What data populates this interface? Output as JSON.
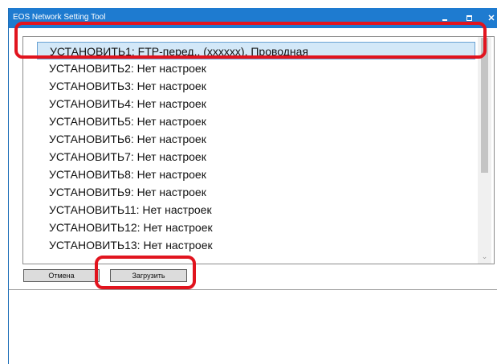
{
  "window": {
    "title": "EOS Network Setting Tool"
  },
  "list": {
    "items": [
      "УСТАНОВИТЬ1: FTP-перед., (xxxxxx), Проводная",
      "УСТАНОВИТЬ2: Нет настроек",
      "УСТАНОВИТЬ3: Нет настроек",
      "УСТАНОВИТЬ4: Нет настроек",
      "УСТАНОВИТЬ5: Нет настроек",
      "УСТАНОВИТЬ6: Нет настроек",
      "УСТАНОВИТЬ7: Нет настроек",
      "УСТАНОВИТЬ8: Нет настроек",
      "УСТАНОВИТЬ9: Нет настроек",
      "УСТАНОВИТЬ11: Нет настроек",
      "УСТАНОВИТЬ12: Нет настроек",
      "УСТАНОВИТЬ13: Нет настроек"
    ],
    "selected_index": 0
  },
  "buttons": {
    "cancel": "Отмена",
    "load": "Загрузить"
  },
  "colors": {
    "titlebar": "#1e7bd0",
    "selection": "#d3e8f8",
    "highlight": "#e1141e"
  }
}
